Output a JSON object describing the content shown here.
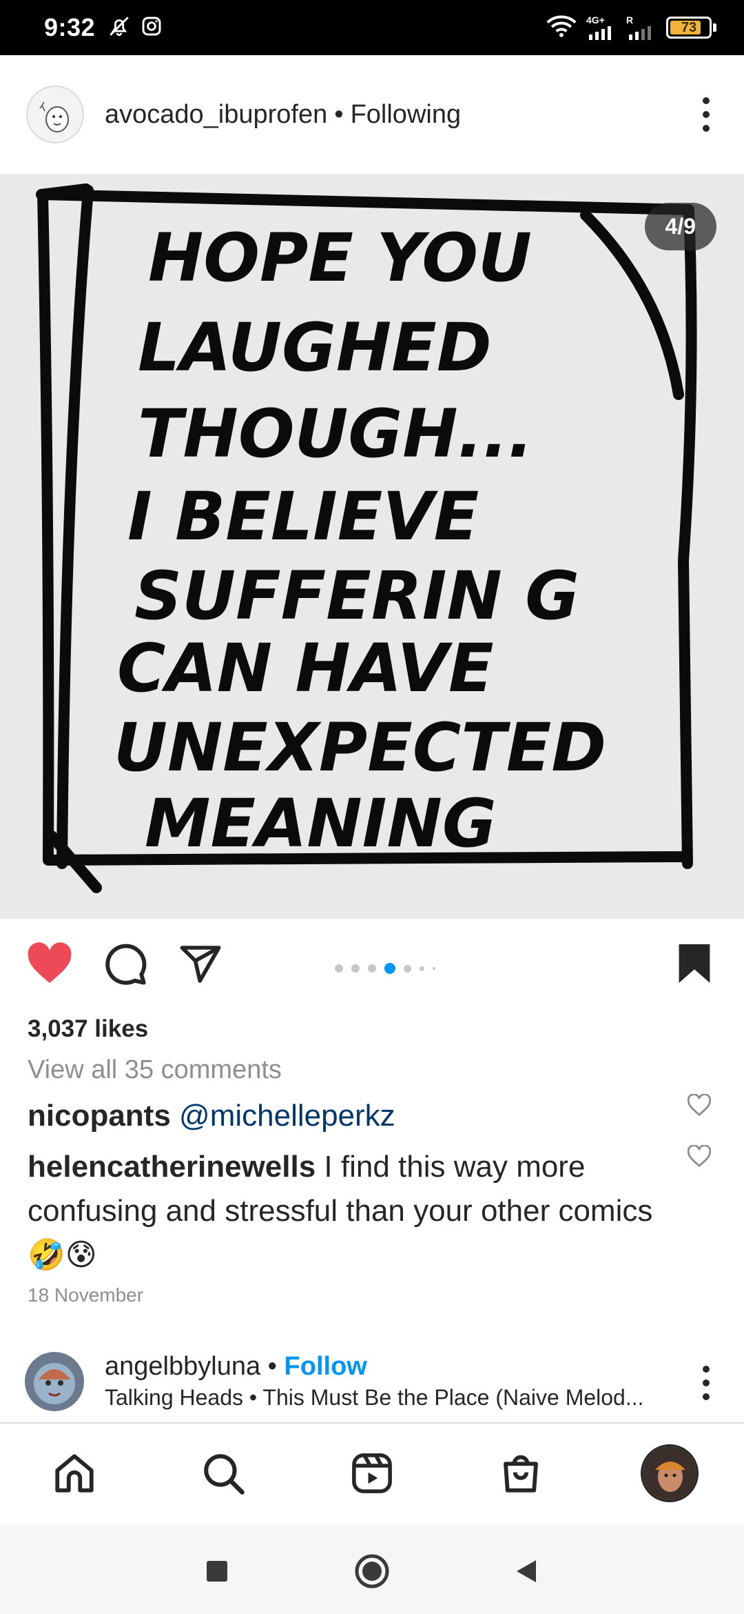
{
  "status_bar": {
    "time": "9:32",
    "network": "4G+",
    "roaming": "R",
    "battery": "73",
    "icons": [
      "bell-off-icon",
      "instagram-icon",
      "wifi-icon",
      "signal-icon",
      "battery-icon"
    ]
  },
  "post": {
    "username": "avocado_ibuprofen",
    "separator": "•",
    "follow_status": "Following",
    "carousel_position": "4/9",
    "image_lines": [
      "HOPE YOU",
      "LAUGHED",
      "THOUGH...",
      "I BELIEVE",
      "SUFFERIN G",
      "CAN HAVE",
      "UNEXPECTED",
      "MEANING"
    ],
    "likes": "3,037 likes",
    "view_comments": "View all 35 comments",
    "liked": true,
    "saved": true,
    "carousel_dots_total": 6,
    "carousel_active_index": 3
  },
  "comments": [
    {
      "user": "nicopants",
      "text": "@michelleperkz"
    },
    {
      "user": "helencatherinewells",
      "text": "I find this way more confusing and stressful than your other comics 🤣😰"
    }
  ],
  "date": "18 November",
  "next_post": {
    "username": "angelbbyluna",
    "separator": "•",
    "follow_label": "Follow",
    "music": "Talking Heads • This Must Be the Place (Naive Melod..."
  },
  "colors": {
    "heart": "#ed4956",
    "link": "#0095f6",
    "mention": "#00376b",
    "muted": "#8e8e8e",
    "dot_active": "#0095f6"
  },
  "bottom_nav": [
    "home-icon",
    "search-icon",
    "reels-icon",
    "shop-icon",
    "profile-avatar"
  ],
  "system_nav": [
    "recents-button",
    "home-button",
    "back-button"
  ]
}
